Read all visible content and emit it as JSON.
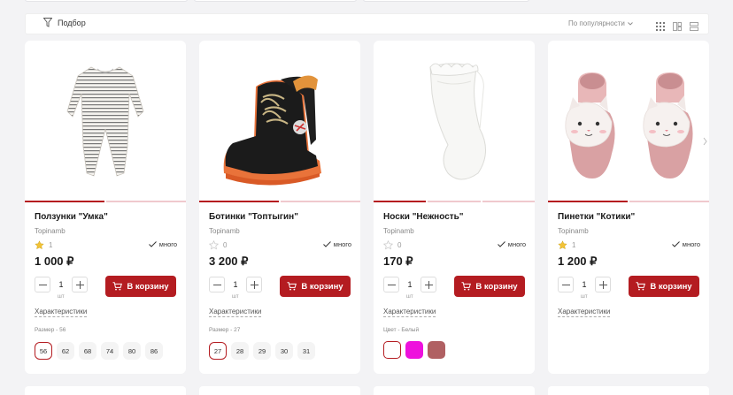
{
  "toolbar": {
    "filter_label": "Подбор",
    "sort_label": "По популярности"
  },
  "products": [
    {
      "title": "Ползунки \"Умка\"",
      "brand": "Topinamb",
      "rating": "1",
      "rated": true,
      "stock": "много",
      "price": "1 000 ₽",
      "qty": "1",
      "unit": "шт",
      "cart_label": "В корзину",
      "spec_label": "Характеристики",
      "option_label": "Размер - 56",
      "options": [
        "56",
        "62",
        "68",
        "74",
        "80",
        "86"
      ],
      "selected_option": "56"
    },
    {
      "title": "Ботинки \"Топтыгин\"",
      "brand": "Topinamb",
      "rating": "0",
      "rated": false,
      "stock": "много",
      "price": "3 200 ₽",
      "qty": "1",
      "unit": "шт",
      "cart_label": "В корзину",
      "spec_label": "Характеристики",
      "option_label": "Размер - 27",
      "options": [
        "27",
        "28",
        "29",
        "30",
        "31"
      ],
      "selected_option": "27"
    },
    {
      "title": "Носки \"Нежность\"",
      "brand": "Topinamb",
      "rating": "0",
      "rated": false,
      "stock": "много",
      "price": "170 ₽",
      "qty": "1",
      "unit": "шт",
      "cart_label": "В корзину",
      "spec_label": "Характеристики",
      "option_label": "Цвет - Белый",
      "colors": [
        "#ffffff",
        "#ee11dd",
        "#b06062"
      ]
    },
    {
      "title": "Пинетки \"Котики\"",
      "brand": "Topinamb",
      "rating": "1",
      "rated": true,
      "stock": "много",
      "price": "1 200 ₽",
      "qty": "1",
      "unit": "шт",
      "cart_label": "В корзину",
      "spec_label": "Характеристики"
    }
  ],
  "colors": {
    "accent": "#b41c21",
    "star_filled": "#f2c236",
    "indicator_inactive": "#f0c9cd"
  }
}
